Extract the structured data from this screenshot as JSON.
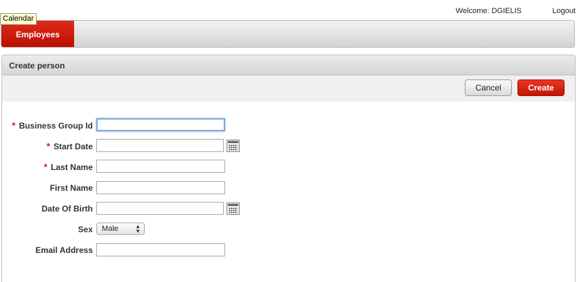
{
  "tooltip": {
    "text": "Calendar"
  },
  "header": {
    "welcome": "Welcome: DGIELIS",
    "logout": "Logout"
  },
  "tabs": [
    {
      "label": "Employees",
      "active": true
    }
  ],
  "region": {
    "title": "Create person"
  },
  "buttons": {
    "cancel": "Cancel",
    "create": "Create"
  },
  "form": {
    "fields": [
      {
        "label": "Business Group Id",
        "required": true,
        "value": ""
      },
      {
        "label": "Start Date",
        "required": true,
        "value": ""
      },
      {
        "label": "Last Name",
        "required": true,
        "value": ""
      },
      {
        "label": "First Name",
        "required": false,
        "value": ""
      },
      {
        "label": "Date Of Birth",
        "required": false,
        "value": ""
      },
      {
        "label": "Sex",
        "required": false,
        "value": "Male"
      },
      {
        "label": "Email Address",
        "required": false,
        "value": ""
      }
    ],
    "required_marker": "*"
  },
  "colors": {
    "brand_red": "#d2190a",
    "focus_blue": "#7aa7d8"
  }
}
